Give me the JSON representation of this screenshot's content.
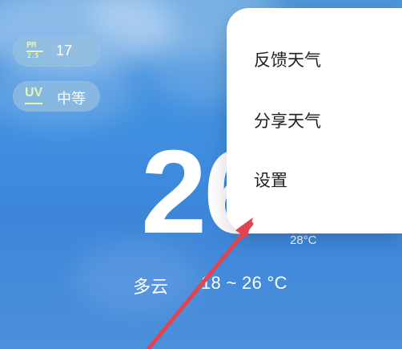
{
  "weather": {
    "pm25_icon": {
      "top": "PM",
      "bottom": "2.5"
    },
    "pm25_value": "17",
    "uv_icon": "UV",
    "uv_value": "中等",
    "current_temperature": "26",
    "feels_like": "28°C",
    "condition": "多云",
    "range": "18 ~ 26 °C"
  },
  "menu": {
    "items": [
      {
        "label": "反馈天气"
      },
      {
        "label": "分享天气"
      },
      {
        "label": "设置"
      }
    ]
  },
  "colors": {
    "sky": "#3F8FE0",
    "pill": "#94BFDF",
    "icon_accent": "#E5F7B0",
    "menu_bg": "#FFFFFF",
    "menu_text": "#222222",
    "arrow": "#E2444F"
  },
  "icons": {
    "pm25": "pm25-icon",
    "uv": "uv-icon",
    "annotation": "red-arrow-icon"
  }
}
